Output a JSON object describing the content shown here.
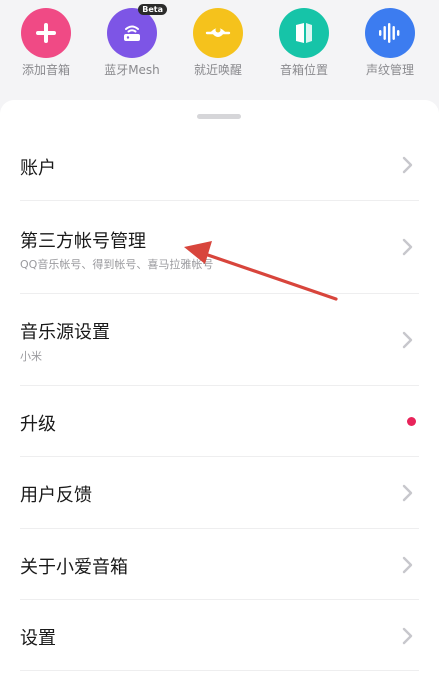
{
  "shortcuts": [
    {
      "label": "添加音箱",
      "icon": "plus-icon",
      "color": "#f04a85"
    },
    {
      "label": "蓝牙Mesh",
      "icon": "router-icon",
      "color": "#7d55e6",
      "badge": "Beta"
    },
    {
      "label": "就近唤醒",
      "icon": "wake-icon",
      "color": "#f5c21c"
    },
    {
      "label": "音箱位置",
      "icon": "location-icon",
      "color": "#16c4a8"
    },
    {
      "label": "声纹管理",
      "icon": "voiceprint-icon",
      "color": "#3c7cf0"
    }
  ],
  "menu": [
    {
      "title": "账户",
      "subtitle": ""
    },
    {
      "title": "第三方帐号管理",
      "subtitle": "QQ音乐帐号、得到帐号、喜马拉雅帐号"
    },
    {
      "title": "音乐源设置",
      "subtitle": "小米"
    },
    {
      "title": "升级",
      "subtitle": "",
      "indicator": "red-dot"
    },
    {
      "title": "用户反馈",
      "subtitle": ""
    },
    {
      "title": "关于小爱音箱",
      "subtitle": ""
    },
    {
      "title": "设置",
      "subtitle": ""
    }
  ],
  "colors": {
    "annotation_arrow": "#d8453c",
    "update_dot": "#e8245a",
    "chevron": "#c7c7cc"
  }
}
